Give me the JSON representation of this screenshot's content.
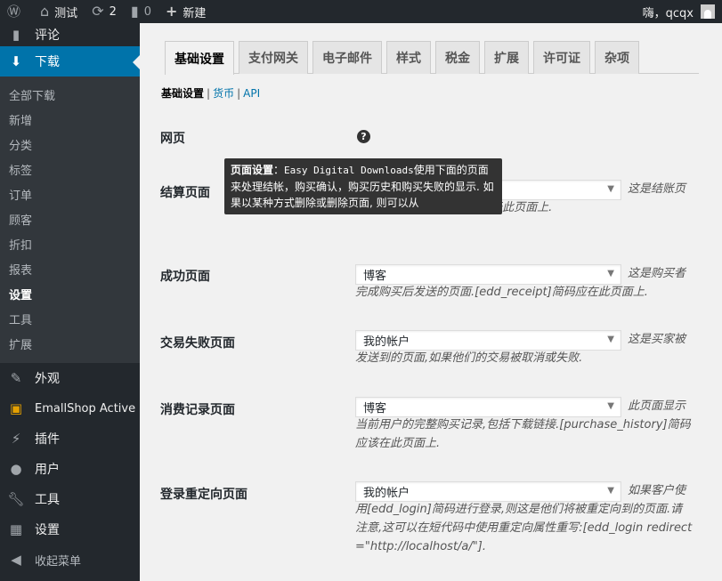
{
  "adminbar": {
    "site_name": "测试",
    "updates_count": "2",
    "comments_count": "0",
    "new_label": "新建",
    "greeting": "嗨，qcqx"
  },
  "sidebar": {
    "top": [
      {
        "label": "评论",
        "icon": "comment-icon"
      },
      {
        "label": "下载",
        "icon": "download-icon"
      }
    ],
    "submenu": [
      "全部下载",
      "新增",
      "分类",
      "标签",
      "订单",
      "顾客",
      "折扣",
      "报表",
      "设置",
      "工具",
      "扩展"
    ],
    "bottom": [
      {
        "label": "外观",
        "icon": "brush-icon"
      },
      {
        "label": "EmallShop Active",
        "icon": "theme-icon"
      },
      {
        "label": "插件",
        "icon": "plugin-icon"
      },
      {
        "label": "用户",
        "icon": "user-icon"
      },
      {
        "label": "工具",
        "icon": "wrench-icon"
      },
      {
        "label": "设置",
        "icon": "settings-icon"
      },
      {
        "label": "收起菜单",
        "icon": "collapse-icon"
      }
    ]
  },
  "tabs": [
    "基础设置",
    "支付网关",
    "电子邮件",
    "样式",
    "税金",
    "扩展",
    "许可证",
    "杂项"
  ],
  "subnav": {
    "current": "基础设置",
    "links": [
      "货币",
      "API"
    ]
  },
  "section_title": "网页",
  "tooltip": {
    "title": "页面设置",
    "body_pre": "：",
    "mono": "Easy Digital Downloads",
    "body": "使用下面的页面来处理结帐，购买确认，购买历史和购买失败的显示. 如果以某种方式删除或删除页面, 则可以从"
  },
  "rows": [
    {
      "label": "结算页面",
      "value": "",
      "desc_head": "这是结账页",
      "desc": "ad_checkout]简码必须位于此页面上."
    },
    {
      "label": "成功页面",
      "value": "博客",
      "desc_head": "这是购买者",
      "desc": "完成购买后发送的页面.[edd_receipt]简码应在此页面上."
    },
    {
      "label": "交易失败页面",
      "value": "我的帐户",
      "desc_head": "这是买家被",
      "desc": "发送到的页面,如果他们的交易被取消或失败."
    },
    {
      "label": "消费记录页面",
      "value": "博客",
      "desc_head": "此页面显示",
      "desc": "当前用户的完整购买记录,包括下载链接.[purchase_history]简码应该在此页面上."
    },
    {
      "label": "登录重定向页面",
      "value": "我的帐户",
      "desc_head": "如果客户使",
      "desc": "用[edd_login]简码进行登录,则这是他们将被重定向到的页面.请注意,这可以在短代码中使用重定向属性重写:[edd_login redirect =\"http://localhost/a/\"]."
    }
  ]
}
